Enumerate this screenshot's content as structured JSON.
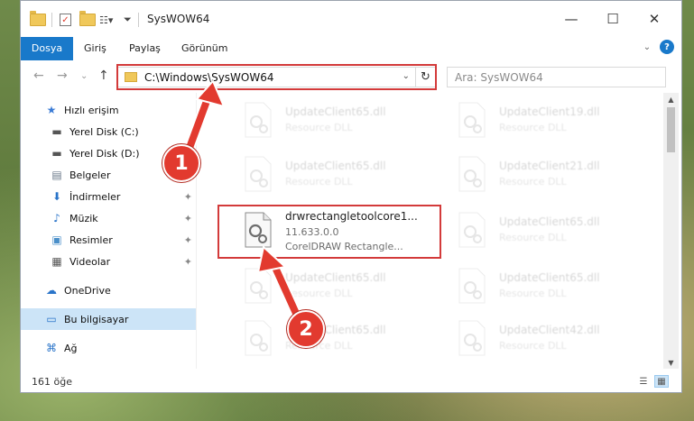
{
  "window": {
    "title": "SysWOW64",
    "minimize_glyph": "—",
    "maximize_glyph": "☐",
    "close_glyph": "✕"
  },
  "ribbon": {
    "tabs": [
      "Dosya",
      "Giriş",
      "Paylaş",
      "Görünüm"
    ],
    "expand_glyph": "⌄",
    "help_glyph": "?"
  },
  "nav": {
    "back_glyph": "←",
    "forward_glyph": "→",
    "recent_glyph": "⌄",
    "up_glyph": "↑",
    "address": "C:\\Windows\\SysWOW64",
    "address_dropdown_glyph": "⌄",
    "refresh_glyph": "↻",
    "search_placeholder": "Ara: SysWOW64"
  },
  "sidebar": {
    "items": [
      {
        "label": "Hızlı erişim",
        "icon": "star-icon",
        "glyph": "★"
      },
      {
        "label": "Yerel Disk (C:)",
        "icon": "drive-icon",
        "glyph": "▬"
      },
      {
        "label": "Yerel Disk (D:)",
        "icon": "drive-icon",
        "glyph": "▬"
      },
      {
        "label": "Belgeler",
        "icon": "documents-icon",
        "glyph": "▤",
        "pinned": true
      },
      {
        "label": "İndirmeler",
        "icon": "download-icon",
        "glyph": "⬇",
        "pinned": true
      },
      {
        "label": "Müzik",
        "icon": "music-icon",
        "glyph": "♪",
        "pinned": true
      },
      {
        "label": "Resimler",
        "icon": "pictures-icon",
        "glyph": "▣",
        "pinned": true
      },
      {
        "label": "Videolar",
        "icon": "video-icon",
        "glyph": "▦",
        "pinned": true
      },
      {
        "label": "OneDrive",
        "icon": "cloud-icon",
        "glyph": "☁"
      },
      {
        "label": "Bu bilgisayar",
        "icon": "computer-icon",
        "glyph": "▭",
        "selected": true
      },
      {
        "label": "Ağ",
        "icon": "network-icon",
        "glyph": "⌘"
      }
    ],
    "pin_glyph": "✦"
  },
  "files": {
    "left": [
      {
        "name": "UpdateClient65.dll",
        "sub": "Resource DLL"
      },
      {
        "name": "UpdateClient65.dll",
        "sub": "Resource DLL"
      },
      {
        "name": "drwrectangletoolcore1...",
        "sub": "11.633.0.0",
        "sub2": "CorelDRAW Rectangle...",
        "highlight": true
      },
      {
        "name": "UpdateClient65.dll",
        "sub": "Resource DLL"
      },
      {
        "name": "UpdateClient65.dll",
        "sub": "Resource DLL"
      }
    ],
    "right": [
      {
        "name": "UpdateClient19.dll",
        "sub": "Resource DLL"
      },
      {
        "name": "UpdateClient21.dll",
        "sub": "Resource DLL"
      },
      {
        "name": "UpdateClient65.dll",
        "sub": "Resource DLL"
      },
      {
        "name": "UpdateClient65.dll",
        "sub": "Resource DLL"
      },
      {
        "name": "UpdateClient42.dll",
        "sub": "Resource DLL"
      }
    ]
  },
  "status": {
    "count": "161 öğe",
    "details_view_glyph": "☰",
    "tiles_view_glyph": "▦"
  },
  "scrollbar": {
    "up_glyph": "▲",
    "down_glyph": "▼"
  },
  "callouts": [
    "1",
    "2"
  ],
  "colors": {
    "accent": "#1979ca",
    "highlight": "#d33a3a",
    "selection": "#cce4f7"
  }
}
